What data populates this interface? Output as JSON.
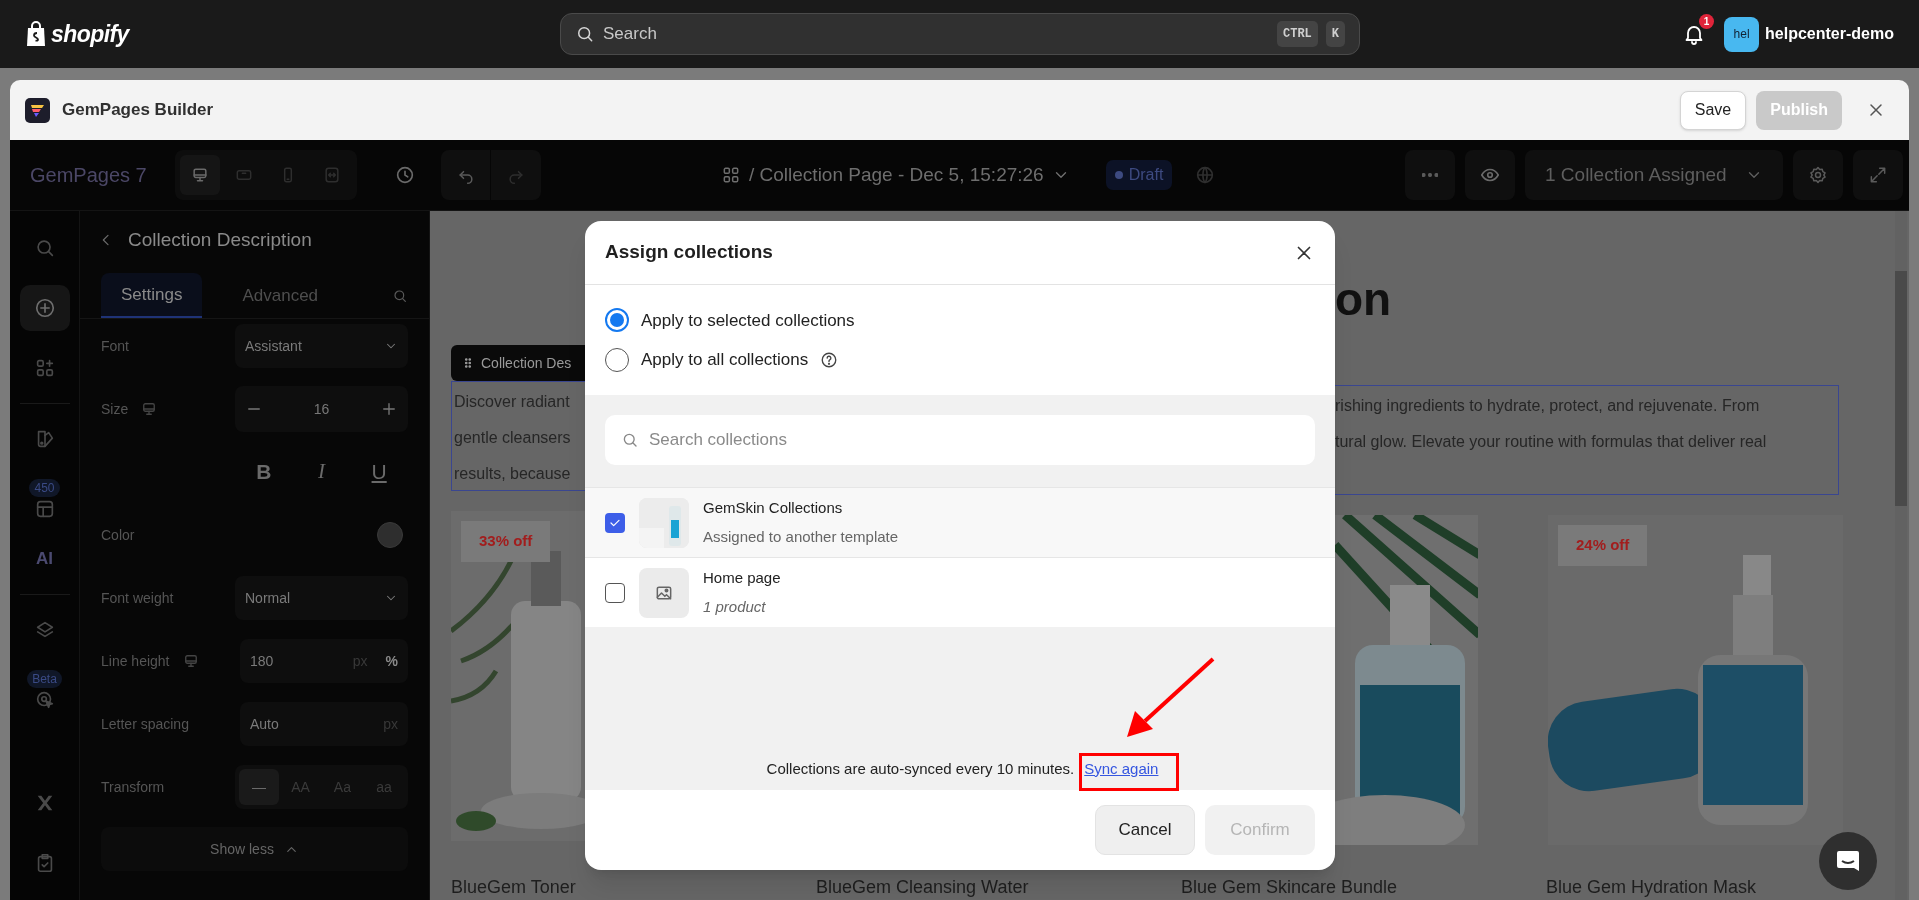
{
  "topbar": {
    "brand": "shopify",
    "search": {
      "placeholder": "Search",
      "keys": [
        "CTRL",
        "K"
      ]
    },
    "notification_count": "1",
    "account": {
      "initials": "hel",
      "name": "helpcenter-demo"
    }
  },
  "app_header": {
    "title": "GemPages Builder",
    "buttons": [
      {
        "label": "Save",
        "disabled": false
      },
      {
        "label": "Publish",
        "disabled": true
      }
    ]
  },
  "toolbar": {
    "product": "GemPages 7",
    "devices": [
      {
        "kind": "desktop",
        "selected": true
      },
      {
        "kind": "tablet",
        "selected": false
      },
      {
        "kind": "mobile",
        "selected": false
      },
      {
        "kind": "fit",
        "selected": false
      }
    ],
    "page_title": "/ Collection Page - Dec 5, 15:27:26",
    "status": "Draft",
    "assigned": "1 Collection Assigned"
  },
  "rail": {
    "groups": [
      [
        {
          "kind": "search",
          "selected": false
        },
        {
          "kind": "add",
          "selected": true
        },
        {
          "kind": "elements",
          "selected": false
        }
      ],
      [
        {
          "kind": "theme",
          "selected": false
        },
        {
          "kind": "templates",
          "badge": "450",
          "selected": false
        },
        {
          "kind": "ai",
          "label": "AI",
          "selected": false
        }
      ],
      [
        {
          "kind": "layers",
          "selected": false
        },
        {
          "kind": "cursor",
          "badge": "Beta",
          "selected": false
        }
      ],
      [
        {
          "kind": "app",
          "selected": false
        },
        {
          "kind": "checklist",
          "selected": false
        }
      ]
    ]
  },
  "panel": {
    "title": "Collection Description",
    "tabs": [
      {
        "label": "Settings",
        "selected": true
      },
      {
        "label": "Advanced",
        "selected": false
      }
    ],
    "rows": [
      {
        "kind": "select",
        "label": "Font",
        "value": "Assistant"
      },
      {
        "kind": "stepper",
        "label": "Size",
        "responsive": true,
        "value": "16"
      },
      {
        "kind": "format",
        "options": [
          {
            "label": "B",
            "kind": "bold"
          },
          {
            "label": "I",
            "kind": "italic"
          },
          {
            "label": "U",
            "kind": "underline"
          }
        ]
      },
      {
        "kind": "color",
        "label": "Color",
        "color": "#2e2e2e"
      },
      {
        "kind": "select",
        "label": "Font weight",
        "value": "Normal"
      },
      {
        "kind": "unit",
        "label": "Line height",
        "responsive": true,
        "value": "180",
        "units": [
          {
            "label": "px",
            "selected": false
          },
          {
            "label": "%",
            "selected": true
          }
        ]
      },
      {
        "kind": "unit",
        "label": "Letter spacing",
        "responsive": false,
        "value": "Auto",
        "units": [
          {
            "label": "px",
            "selected": false
          }
        ]
      },
      {
        "kind": "segmented",
        "label": "Transform",
        "options": [
          {
            "label": "—",
            "selected": true
          },
          {
            "label": "AA",
            "selected": false
          },
          {
            "label": "Aa",
            "selected": false
          },
          {
            "label": "aa",
            "selected": false
          }
        ]
      }
    ],
    "toggle": "Show less"
  },
  "canvas": {
    "element_label": "Collection Des",
    "heading": "on",
    "description_left": [
      "Discover radiant",
      "gentle cleansers",
      "results, because"
    ],
    "description_right": [
      "rishing ingredients to hydrate, protect, and rejuvenate. From",
      "tural glow. Elevate your routine with formulas that deliver real"
    ],
    "products": [
      {
        "badge": "33% off",
        "name": "BlueGem Toner"
      },
      {
        "name": "BlueGem Cleansing Water"
      },
      {
        "name": "Blue Gem Skincare Bundle"
      },
      {
        "badge": "24% off",
        "name": "Blue Gem Hydration Mask"
      }
    ]
  },
  "modal": {
    "title": "Assign collections",
    "scope": [
      {
        "label": "Apply to selected collections",
        "selected": true,
        "help": false
      },
      {
        "label": "Apply to all collections",
        "selected": false,
        "help": true
      }
    ],
    "search": {
      "placeholder": "Search collections"
    },
    "collections": [
      {
        "name": "GemSkin Collections",
        "note": "Assigned to another template",
        "checked": true,
        "kind": "picture",
        "italic": false
      },
      {
        "name": "Home page",
        "note": "1 product",
        "checked": false,
        "kind": "placeholder",
        "italic": true
      }
    ],
    "sync_note": "Collections are auto-synced every 10 minutes.",
    "sync_link": "Sync again",
    "buttons": [
      {
        "label": "Cancel",
        "disabled": false
      },
      {
        "label": "Confirm",
        "disabled": true
      }
    ]
  }
}
